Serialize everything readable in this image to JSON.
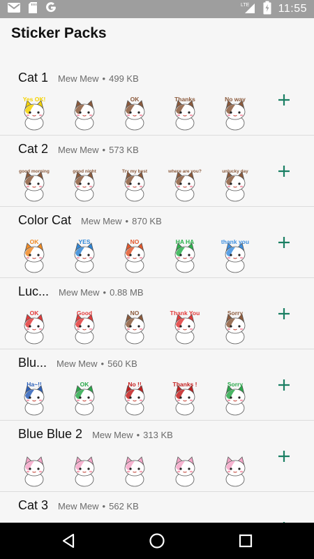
{
  "status_bar": {
    "time": "11:55",
    "network": "LTE",
    "icons": [
      "gmail-icon",
      "sd-card-icon",
      "google-icon",
      "signal-icon",
      "battery-charging-icon"
    ]
  },
  "app": {
    "title": "Sticker Packs"
  },
  "packs": [
    {
      "name": "Cat 1",
      "publisher": "Mew Mew",
      "separator": "•",
      "size": "499 KB",
      "stickers": [
        {
          "text": "Yes OK!",
          "color": "#f4d200"
        },
        {
          "text": "",
          "color": "#8b5a3c"
        },
        {
          "text": "OK",
          "color": "#8b5a3c"
        },
        {
          "text": "Thanks",
          "color": "#8b5a3c"
        },
        {
          "text": "No way",
          "color": "#8b5a3c"
        }
      ]
    },
    {
      "name": "Cat 2",
      "publisher": "Mew Mew",
      "separator": "•",
      "size": "573 KB",
      "stickers": [
        {
          "text": "good morning",
          "color": "#8b5a3c"
        },
        {
          "text": "good night",
          "color": "#8b5a3c"
        },
        {
          "text": "Try my best",
          "color": "#8b5a3c"
        },
        {
          "text": "where are you?",
          "color": "#8b5a3c"
        },
        {
          "text": "unlucky day",
          "color": "#8b5a3c"
        }
      ]
    },
    {
      "name": "Color Cat",
      "publisher": "Mew Mew",
      "separator": "•",
      "size": "870 KB",
      "stickers": [
        {
          "text": "OK",
          "color": "#f08a24"
        },
        {
          "text": "YES",
          "color": "#2f86d6"
        },
        {
          "text": "NO",
          "color": "#e2572b"
        },
        {
          "text": "HA HA",
          "color": "#2bb24c"
        },
        {
          "text": "thank you",
          "color": "#3d8fe0"
        }
      ]
    },
    {
      "name": "Luc...",
      "publisher": "Mew Mew",
      "separator": "•",
      "size": "0.88 MB",
      "stickers": [
        {
          "text": "OK",
          "color": "#e23a3a"
        },
        {
          "text": "Good",
          "color": "#e23a3a"
        },
        {
          "text": "NO",
          "color": "#8b5a3c"
        },
        {
          "text": "Thank You",
          "color": "#e23a3a"
        },
        {
          "text": "Sorry",
          "color": "#8b5a3c"
        }
      ]
    },
    {
      "name": "Blu...",
      "publisher": "Mew Mew",
      "separator": "•",
      "size": "560 KB",
      "stickers": [
        {
          "text": "Ha~!!",
          "color": "#2b5fb8"
        },
        {
          "text": "OK",
          "color": "#2aa84a"
        },
        {
          "text": "No !!",
          "color": "#c21e1e"
        },
        {
          "text": "Thanks !",
          "color": "#c21e1e"
        },
        {
          "text": "Sorry",
          "color": "#2aa84a"
        }
      ]
    },
    {
      "name": "Blue Blue 2",
      "publisher": "Mew Mew",
      "separator": "•",
      "size": "313 KB",
      "stickers": [
        {
          "text": "",
          "color": "#f4a6c8"
        },
        {
          "text": "",
          "color": "#f4a6c8"
        },
        {
          "text": "",
          "color": "#f4a6c8"
        },
        {
          "text": "",
          "color": "#f4a6c8"
        },
        {
          "text": "",
          "color": "#f4a6c8"
        }
      ]
    },
    {
      "name": "Cat 3",
      "publisher": "Mew Mew",
      "separator": "•",
      "size": "562 KB",
      "stickers": []
    }
  ],
  "colors": {
    "accent": "#1a7f63",
    "status_bar": "#9e9e9e",
    "nav_bar": "#000000"
  },
  "nav_bar": {
    "buttons": [
      "back-icon",
      "home-icon",
      "recents-icon"
    ]
  }
}
